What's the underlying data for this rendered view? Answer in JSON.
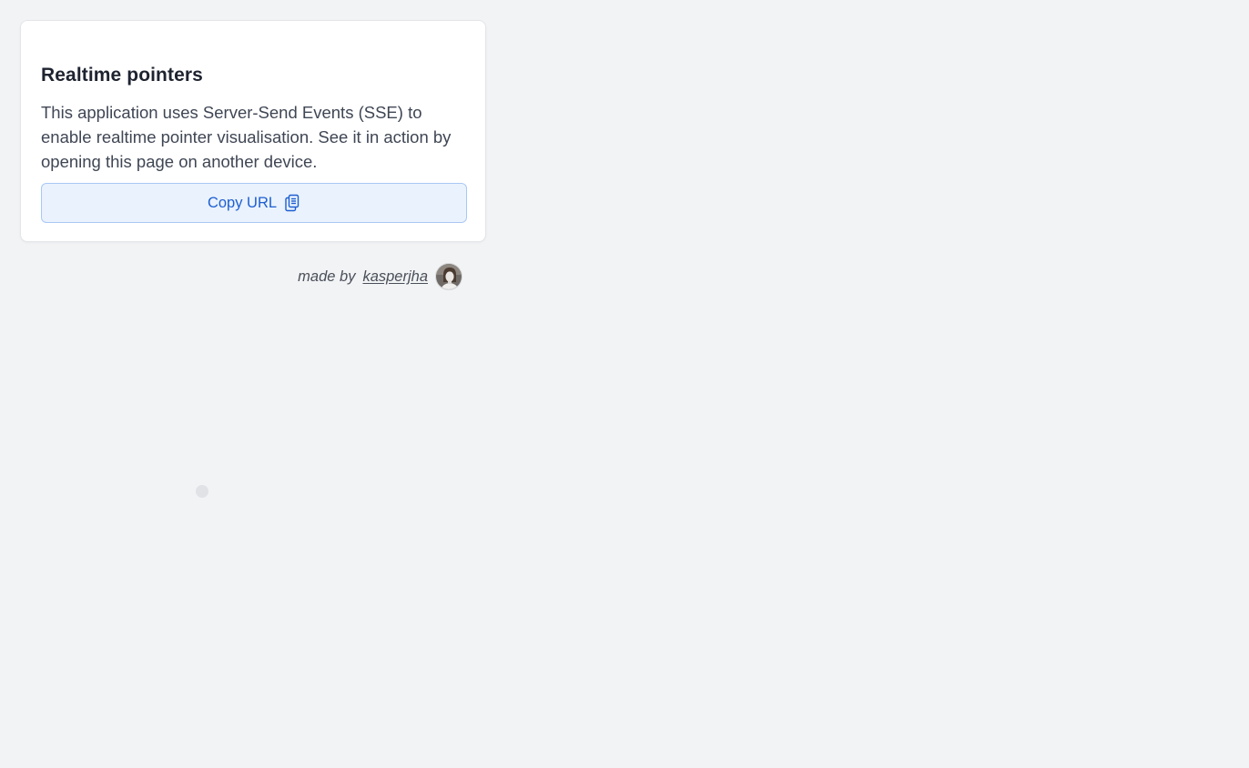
{
  "card": {
    "title": "Realtime pointers",
    "description": "This application uses Server-Send Events (SSE) to enable realtime pointer visualisation. See it in action by opening this page on another device.",
    "copy_button_label": "Copy URL",
    "copy_icon": "clipboard-copy-icon"
  },
  "credit": {
    "prefix": "made by",
    "author": "kasperjha",
    "avatar_icon": "avatar"
  },
  "colors": {
    "background": "#f2f3f5",
    "accent": "#1d5fd0",
    "button_bg": "#eaf2fd",
    "button_border": "#a9c8f4"
  }
}
